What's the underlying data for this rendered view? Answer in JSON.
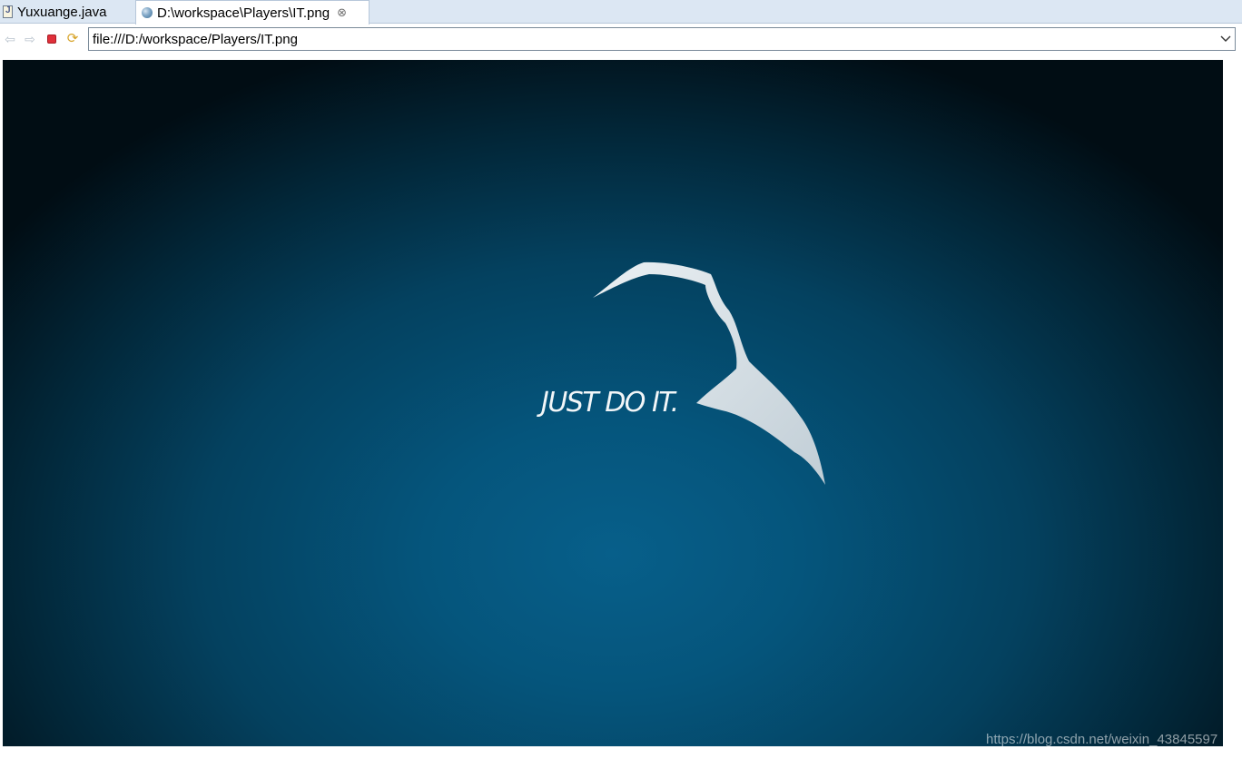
{
  "tabs": [
    {
      "label": "Yuxuange.java",
      "icon": "java-file-icon",
      "active": false
    },
    {
      "label": "D:\\workspace\\Players\\IT.png",
      "icon": "globe-icon",
      "active": true,
      "close": "⊗"
    }
  ],
  "toolbar": {
    "back_icon": "back-arrow-icon",
    "forward_icon": "forward-arrow-icon",
    "stop_icon": "stop-icon",
    "refresh_icon": "refresh-icon"
  },
  "address": {
    "url": "file:///D:/workspace/Players/IT.png"
  },
  "image": {
    "slogan": "JUST DO IT.",
    "colors": {
      "center": "#075f8a",
      "edge": "#010d14",
      "swoosh": "#e8eef2"
    }
  },
  "watermark": "https://blog.csdn.net/weixin_43845597"
}
